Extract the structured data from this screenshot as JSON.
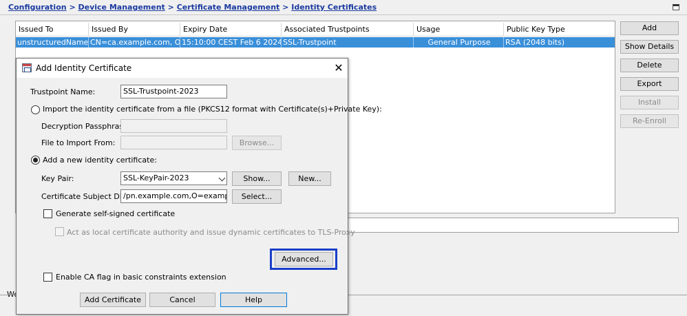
{
  "breadcrumb": {
    "items": [
      "Configuration",
      "Device Management",
      "Certificate Management"
    ],
    "current": "Identity Certificates",
    "separator": ">"
  },
  "table": {
    "columns": [
      "Issued To",
      "Issued By",
      "Expiry Date",
      "Associated Trustpoints",
      "Usage",
      "Public Key Type"
    ],
    "rows": [
      {
        "issued_to": "unstructuredName=...",
        "issued_by": "CN=ca.example.com, OU...",
        "expiry": "15:10:00 CEST Feb 6 2024",
        "trustpoint": "SSL-Trustpoint",
        "usage": "General Purpose",
        "key_type": "RSA (2048 bits)"
      }
    ]
  },
  "side_buttons": {
    "add": "Add",
    "show_details": "Show Details",
    "delete": "Delete",
    "export": "Export",
    "install": "Install",
    "re_enroll": "Re-Enroll"
  },
  "background": {
    "partial_text": "We"
  },
  "dialog": {
    "title": "Add Identity Certificate",
    "close_glyph": "✕",
    "trustpoint_label": "Trustpoint Name:",
    "trustpoint_value": "SSL-Trustpoint-2023",
    "import_option": "Import the identity certificate from a file (PKCS12 format with Certificate(s)+Private Key):",
    "passphrase_label": "Decryption Passphrase:",
    "passphrase_value": "",
    "file_label": "File to Import From:",
    "file_value": "",
    "browse_button": "Browse...",
    "new_option": "Add a new identity certificate:",
    "keypair_label": "Key Pair:",
    "keypair_value": "SSL-KeyPair-2023",
    "show_button": "Show...",
    "new_button": "New...",
    "subject_label": "Certificate Subject DN:",
    "subject_value": "/pn.example.com,O=example inc",
    "select_button": "Select...",
    "self_signed_label": "Generate self-signed certificate",
    "local_ca_label": "Act as local certificate authority and issue dynamic certificates to TLS-Proxy",
    "advanced_button": "Advanced...",
    "ca_flag_label": "Enable CA flag in basic constraints extension",
    "add_cert_button": "Add Certificate",
    "cancel_button": "Cancel",
    "help_button": "Help",
    "selected_option": "new"
  },
  "colors": {
    "selection": "#3a8fd9",
    "link": "#1a3aa0",
    "highlight_box": "#1a3ec8"
  }
}
